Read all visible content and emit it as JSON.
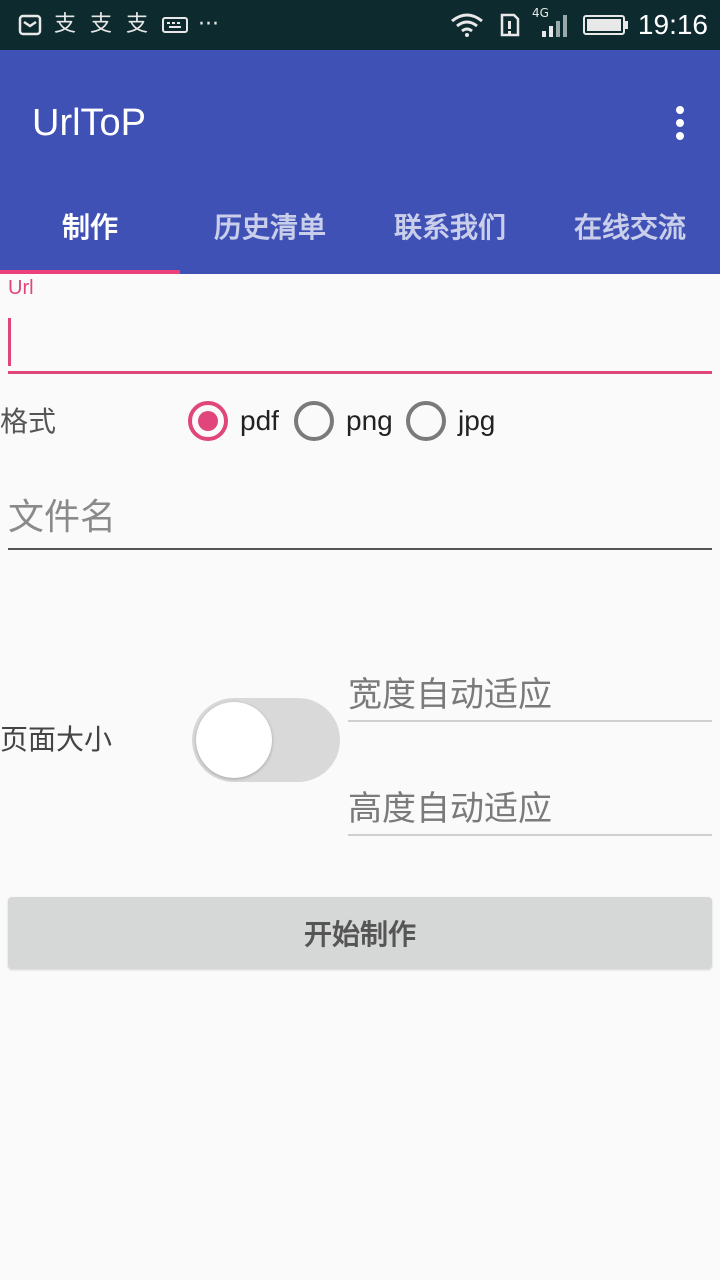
{
  "status_bar": {
    "time": "19:16",
    "network": "4G",
    "icons": [
      "mail-icon",
      "app-notification-icon",
      "app-notification-icon",
      "app-notification-icon",
      "keyboard-icon",
      "more-icon",
      "wifi-icon",
      "sim-icon",
      "signal-icon",
      "battery-icon"
    ]
  },
  "app_bar": {
    "title": "UrlToP",
    "overflow_icon": "more-vert-icon",
    "color": "#3f51b5"
  },
  "tabs": [
    {
      "label": "制作",
      "active": true
    },
    {
      "label": "历史清单",
      "active": false
    },
    {
      "label": "联系我们",
      "active": false
    },
    {
      "label": "在线交流",
      "active": false
    }
  ],
  "form": {
    "url_label": "Url",
    "url_value": "",
    "format_label": "格式",
    "formats": [
      {
        "label": "pdf",
        "checked": true
      },
      {
        "label": "png",
        "checked": false
      },
      {
        "label": "jpg",
        "checked": false
      }
    ],
    "filename_placeholder": "文件名",
    "page_size_label": "页面大小",
    "page_size_switch_on": false,
    "width_placeholder": "宽度自动适应",
    "height_placeholder": "高度自动适应",
    "start_button": "开始制作"
  },
  "colors": {
    "accent": "#e0457b",
    "primary": "#3f51b5",
    "status_bar": "#0d2a2e"
  }
}
